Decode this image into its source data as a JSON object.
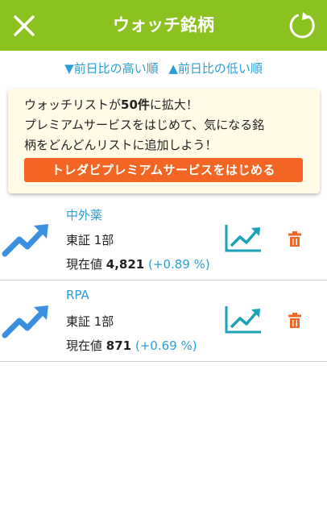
{
  "header": {
    "title": "ウォッチ銘柄",
    "close_icon": "close-icon",
    "refresh_icon": "refresh-icon"
  },
  "sort": {
    "desc_label": "▼前日比の高い順",
    "asc_label": "▲前日比の低い順"
  },
  "promo": {
    "line1_pre": "ウォッチリストが",
    "line1_bold": "50件",
    "line1_post": "に拡大！",
    "line2": "プレミアムサービスをはじめて、気になる銘",
    "line3": "柄をどんどんリストに追加しよう！",
    "cta_label": "トレダビプレミアムサービスをはじめる"
  },
  "stocks": [
    {
      "name": "中外薬",
      "market": "東証 1部",
      "price_label": "現在値",
      "price": "4,821",
      "change": "(+0.89 %)"
    },
    {
      "name": "RPA",
      "market": "東証 1部",
      "price_label": "現在値",
      "price": "871",
      "change": "(+0.69 %)"
    }
  ],
  "colors": {
    "header_bg": "#8cc21f",
    "accent_blue": "#2a9fd6",
    "cta_orange": "#f26522",
    "trash_orange": "#f26522",
    "chart_teal": "#1aa3b8",
    "promo_bg": "#fffbe6"
  }
}
